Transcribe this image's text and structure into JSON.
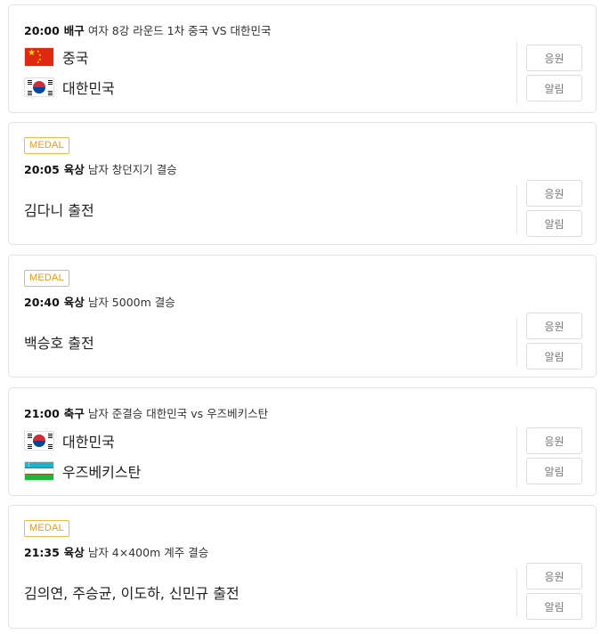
{
  "buttons": {
    "cheer": "응원",
    "alarm": "알림"
  },
  "cards": [
    {
      "time": "20:00",
      "sport": "배구",
      "event": "여자 8강 라운드 1차 중국 VS 대한민국",
      "teams": [
        {
          "name": "중국",
          "flag": "china-flag-icon"
        },
        {
          "name": "대한민국",
          "flag": "korea-flag-icon"
        }
      ]
    },
    {
      "badge": "MEDAL",
      "time": "20:05",
      "sport": "육상",
      "event": "남자 창던지기 결승",
      "participant": "김다니 출전"
    },
    {
      "badge": "MEDAL",
      "time": "20:40",
      "sport": "육상",
      "event": "남자 5000m 결승",
      "participant": "백승호 출전"
    },
    {
      "time": "21:00",
      "sport": "축구",
      "event": "남자 준결승 대한민국 vs 우즈베키스탄",
      "teams": [
        {
          "name": "대한민국",
          "flag": "korea-flag-icon"
        },
        {
          "name": "우즈베키스탄",
          "flag": "uzbekistan-flag-icon"
        }
      ]
    },
    {
      "badge": "MEDAL",
      "time": "21:35",
      "sport": "육상",
      "event": "남자 4×400m 계주 결승",
      "participant": "김의연, 주승균, 이도하, 신민규 출전"
    }
  ]
}
